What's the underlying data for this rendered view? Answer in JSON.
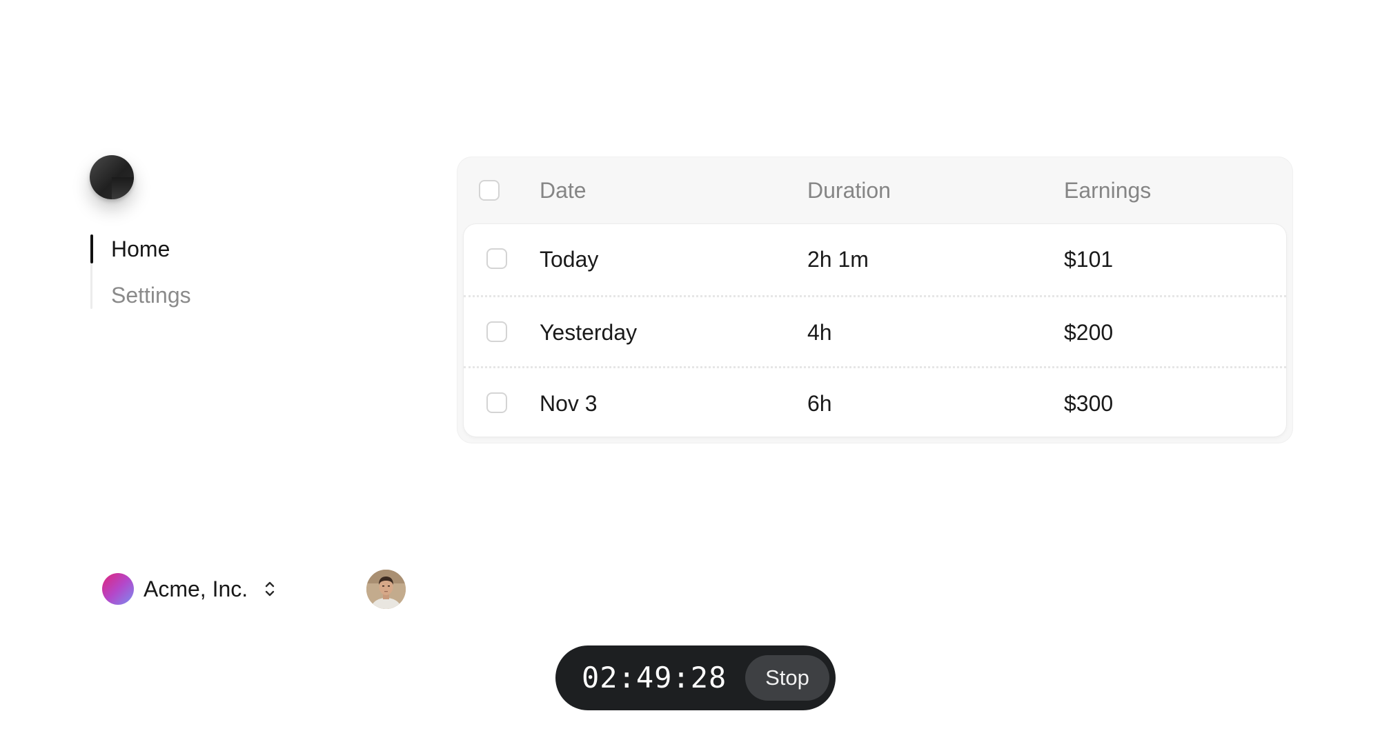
{
  "sidebar": {
    "logo_icon": "app-logo",
    "nav": [
      {
        "label": "Home",
        "active": true
      },
      {
        "label": "Settings",
        "active": false
      }
    ]
  },
  "workspace": {
    "name": "Acme, Inc.",
    "icon": "chevron-up-down-icon"
  },
  "user": {
    "avatar_icon": "user-avatar"
  },
  "table": {
    "columns": [
      "Date",
      "Duration",
      "Earnings"
    ],
    "rows": [
      {
        "date": "Today",
        "duration": "2h 1m",
        "earnings": "$101"
      },
      {
        "date": "Yesterday",
        "duration": "4h",
        "earnings": "$200"
      },
      {
        "date": "Nov 3",
        "duration": "6h",
        "earnings": "$300"
      }
    ]
  },
  "timer": {
    "time": "02:49:28",
    "stop_label": "Stop"
  },
  "colors": {
    "text_primary": "#1a1a1a",
    "text_muted": "#858585",
    "timer_bg": "#1d1f21",
    "stop_bg": "#3e4043"
  }
}
